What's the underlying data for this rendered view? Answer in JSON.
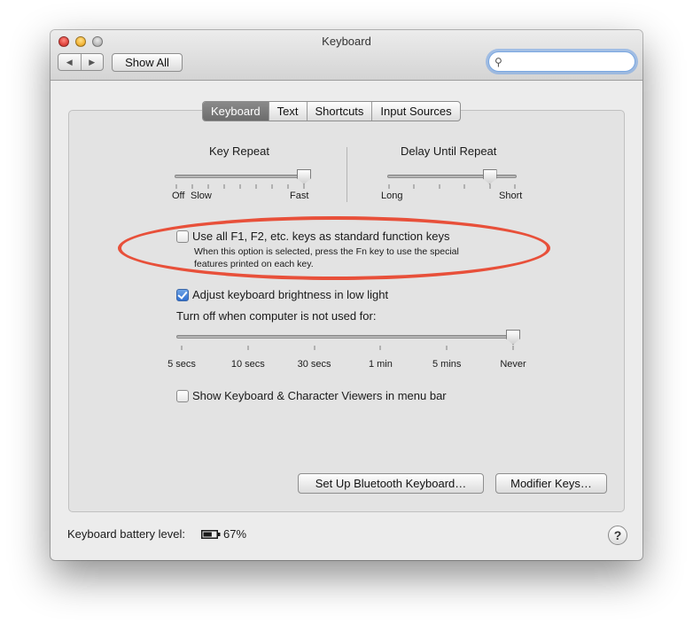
{
  "window": {
    "title": "Keyboard"
  },
  "toolbar": {
    "back_label": "◀",
    "forward_label": "▶",
    "show_all_label": "Show All",
    "search_icon": "magnifier-icon",
    "search_value": ""
  },
  "tabs": [
    {
      "label": "Keyboard",
      "active": true
    },
    {
      "label": "Text",
      "active": false
    },
    {
      "label": "Shortcuts",
      "active": false
    },
    {
      "label": "Input Sources",
      "active": false
    }
  ],
  "key_repeat": {
    "title": "Key Repeat",
    "left_labels": [
      "Off",
      "Slow"
    ],
    "right_label": "Fast",
    "value_fraction": 1.0
  },
  "delay_until_repeat": {
    "title": "Delay Until Repeat",
    "left_label": "Long",
    "right_label": "Short",
    "value_fraction": 0.8
  },
  "function_keys": {
    "label": "Use all F1, F2, etc. keys as standard function keys",
    "checked": false,
    "description_line1": "When this option is selected, press the Fn key to use the special",
    "description_line2": "features printed on each key."
  },
  "brightness": {
    "label": "Adjust keyboard brightness in low light",
    "checked": true,
    "turn_off_label": "Turn off when computer is not used for:",
    "ticks": [
      "5 secs",
      "10 secs",
      "30 secs",
      "1 min",
      "5 mins",
      "Never"
    ],
    "selected": "Never"
  },
  "viewers": {
    "label": "Show Keyboard & Character Viewers in menu bar",
    "checked": false
  },
  "buttons": {
    "bluetooth": "Set Up Bluetooth Keyboard…",
    "modifier": "Modifier Keys…"
  },
  "battery": {
    "label": "Keyboard battery level:",
    "icon": "battery-icon",
    "value": "67%",
    "level_fraction": 0.67
  },
  "help_label": "?",
  "colors": {
    "annotation": "#e8503a",
    "checkbox_accent": "#2f6fd0"
  }
}
